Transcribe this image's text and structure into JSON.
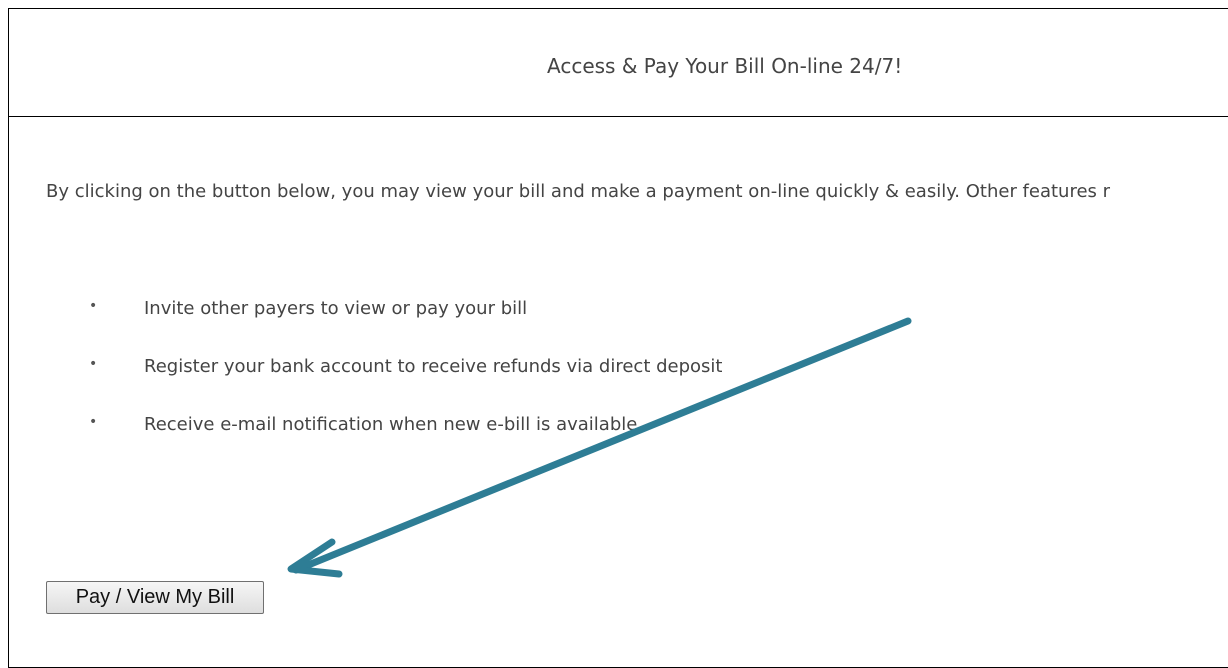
{
  "header": {
    "title": "Access & Pay Your Bill On-line 24/7!"
  },
  "intro": {
    "text": "By clicking on the button below, you may view your bill and make a payment on-line quickly & easily. Other features r"
  },
  "features": {
    "bullet": "•",
    "items": [
      "Invite other payers to view or pay your bill",
      "Register your bank account to receive refunds via direct deposit",
      "Receive e-mail notification when new e-bill is available"
    ]
  },
  "pay_button": {
    "label": "Pay / View My Bill"
  },
  "colors": {
    "arrow": "#2e7d95",
    "border": "#000000",
    "text": "#444444"
  },
  "annotation": {
    "icon": "arrow-icon"
  }
}
